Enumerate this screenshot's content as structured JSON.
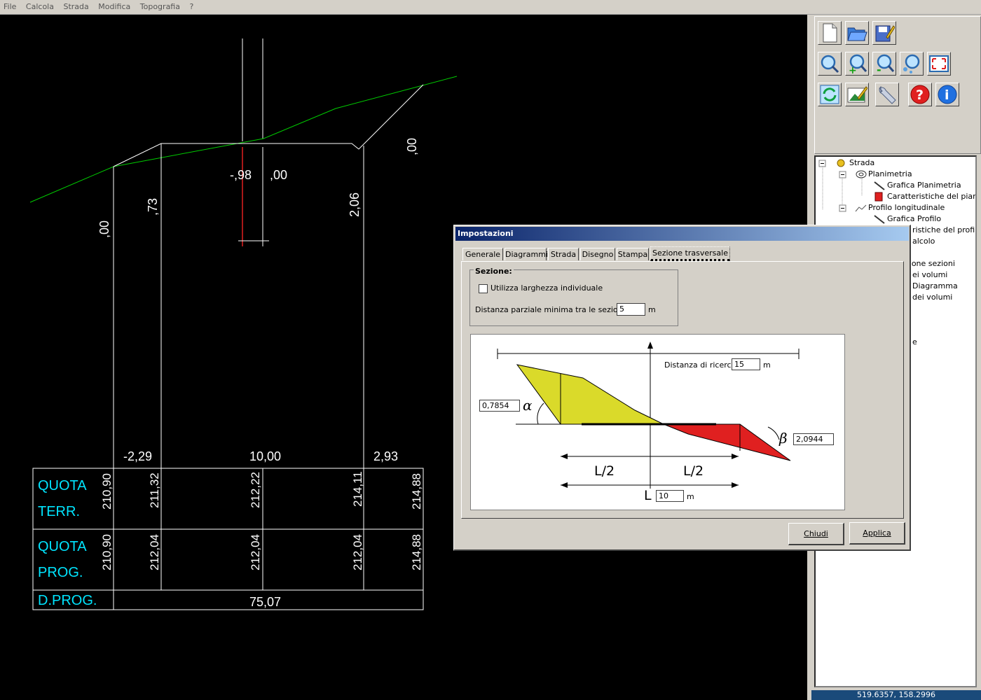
{
  "menu": [
    "File",
    "Calcola",
    "Strada",
    "Modifica",
    "Topografia",
    "?"
  ],
  "canvas": {
    "profile_labels": {
      "left_00": ",00",
      "l73": ",73",
      "m98": "-,98",
      "m00": ",00",
      "r206": "2,06",
      "r00": ",00"
    },
    "distances": {
      "d1": "-2,29",
      "d2": "10,00",
      "d3": "2,93"
    },
    "table": {
      "quota_terr_1": "QUOTA",
      "quota_terr_2": "TERR.",
      "quota_prog_1": "QUOTA",
      "quota_prog_2": "PROG.",
      "dprog": "D.PROG.",
      "terr_values": [
        "210,90",
        "211,32",
        "212,22",
        "214,11",
        "214,88"
      ],
      "prog_values": [
        "210,90",
        "212,04",
        "212,04",
        "212,04",
        "214,88"
      ],
      "dprog_value": "75,07"
    }
  },
  "tree": {
    "strada": "Strada",
    "planimetria": "Planimetria",
    "grafica_planimetria": "Grafica Planimetria",
    "caratteristiche_piano": "Caratteristiche del piano",
    "profilo": "Profilo longitudinale",
    "grafica_profilo": "Grafica Profilo",
    "car_profilo_part": "ristiche del profilo",
    "calcolo_part": "alcolo",
    "sezioni_part": "zione sezioni",
    "volumi_part": "ei volumi",
    "diagramma_part": "Diagramma",
    "dei_volumi_part": "dei volumi",
    "e_part": "e"
  },
  "statusbar": "519.6357,  158.2996",
  "dialog": {
    "title": "Impostazioni",
    "tabs": [
      "Generale",
      "Diagrammi",
      "Strada",
      "Disegno",
      "Stampa",
      "Sezione trasversale"
    ],
    "group_title": "Sezione:",
    "checkbox_label": "Utilizza larghezza individuale",
    "distanza_label": "Distanza parziale minima tra le sezioni:",
    "distanza_value": "5",
    "distanza_unit": "m",
    "ricerca_label": "Distanza di ricerca:",
    "ricerca_value": "15",
    "ricerca_unit": "m",
    "alpha_value": "0,7854",
    "alpha_symbol": "α",
    "beta_value": "2,0944",
    "beta_symbol": "β",
    "half_left": "L/2",
    "half_right": "L/2",
    "l_label": "L",
    "l_value": "10",
    "l_unit": "m",
    "close_button": "Chiudi",
    "apply_button": "Applica"
  },
  "colors": {
    "terrain": "#00cc00",
    "cut": "#dada2a",
    "fill": "#e02020",
    "table_text": "#00e5ff"
  }
}
